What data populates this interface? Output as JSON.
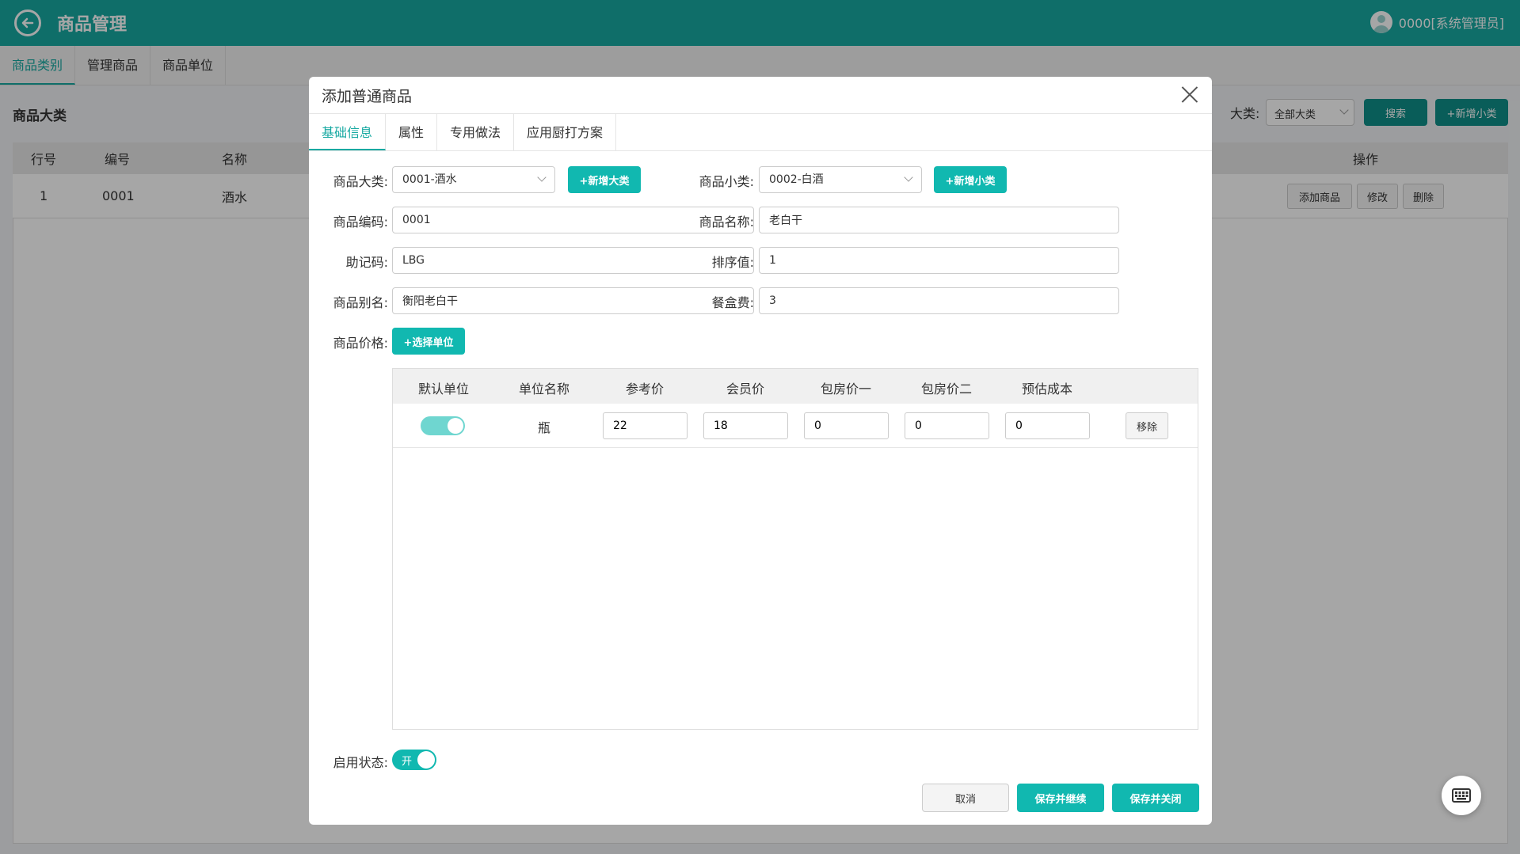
{
  "header": {
    "title": "商品管理",
    "user": "0000[系统管理员]"
  },
  "main_tabs": [
    {
      "label": "商品类别",
      "active": true
    },
    {
      "label": "管理商品",
      "active": false
    },
    {
      "label": "商品单位",
      "active": false
    }
  ],
  "background": {
    "section_title": "商品大类",
    "filter_label": "大类:",
    "filter_value": "全部大类",
    "search_label": "搜索",
    "add_small_label": "+新增小类",
    "table_headers": [
      "行号",
      "编号",
      "名称",
      "操作"
    ],
    "row": {
      "index": "1",
      "code": "0001",
      "name": "酒水"
    },
    "row_actions": [
      "添加商品",
      "修改",
      "删除"
    ]
  },
  "dialog": {
    "title": "添加普通商品",
    "tabs": [
      {
        "label": "基础信息",
        "active": true
      },
      {
        "label": "属性",
        "active": false
      },
      {
        "label": "专用做法",
        "active": false
      },
      {
        "label": "应用厨打方案",
        "active": false
      }
    ],
    "fields": {
      "category_label": "商品大类:",
      "category_value": "0001-酒水",
      "add_category_label": "+新增大类",
      "subcategory_label": "商品小类:",
      "subcategory_value": "0002-白酒",
      "add_subcategory_label": "+新增小类",
      "code_label": "商品编码:",
      "code_value": "0001",
      "name_label": "商品名称:",
      "name_value": "老白干",
      "mnemonic_label": "助记码:",
      "mnemonic_value": "LBG",
      "sort_label": "排序值:",
      "sort_value": "1",
      "alias_label": "商品别名:",
      "alias_value": "衡阳老白干",
      "boxfee_label": "餐盒费:",
      "boxfee_value": "3",
      "price_label": "商品价格:",
      "select_unit_label": "+选择单位"
    },
    "price_table": {
      "headers": [
        "默认单位",
        "单位名称",
        "参考价",
        "会员价",
        "包房价一",
        "包房价二",
        "预估成本"
      ],
      "rows": [
        {
          "unit": "瓶",
          "ref_price": "22",
          "member_price": "18",
          "room_price1": "0",
          "room_price2": "0",
          "est_cost": "0",
          "remove": "移除"
        }
      ]
    },
    "status_label": "启用状态:",
    "status_toggle": "开",
    "cancel_label": "取消",
    "save_continue_label": "保存并继续",
    "save_close_label": "保存并关闭"
  },
  "colors": {
    "primary": "#17a9a2",
    "button": "#11b8b0"
  }
}
